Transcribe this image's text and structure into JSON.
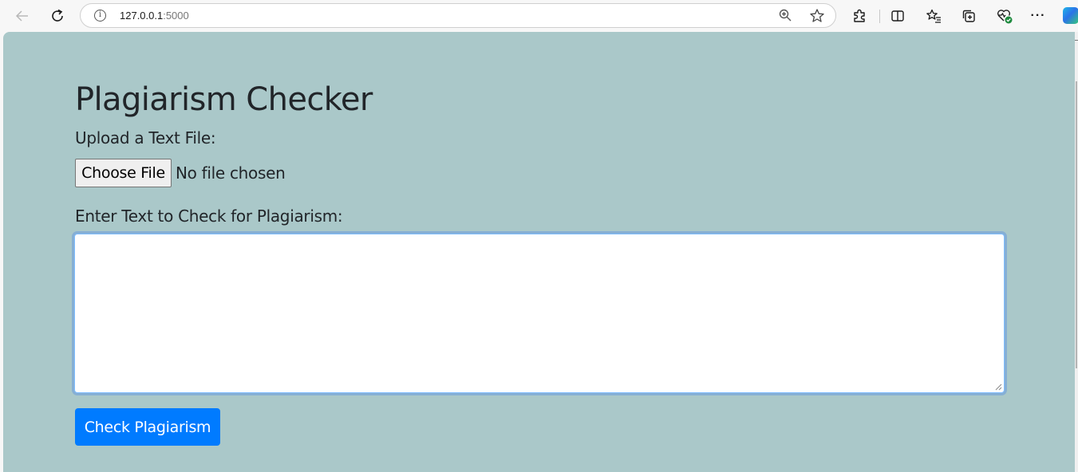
{
  "browser": {
    "url_host": "127.0.0.1",
    "url_port": ":5000",
    "icons": {
      "back": "arrow-left",
      "reload": "reload",
      "site_info": "info-circle",
      "zoom": "zoom-in-magnifier",
      "favorite": "star-outline",
      "extensions": "puzzle-piece",
      "split_screen": "split-screen",
      "favorites": "star-list",
      "collections": "collections",
      "browser_essentials": "heart-pulse",
      "menu": "more-dots",
      "copilot": "copilot-logo"
    }
  },
  "page": {
    "background_color": "#aac8c9",
    "title": "Plagiarism Checker",
    "upload_label": "Upload a Text File:",
    "choose_file_label": "Choose File",
    "no_file_text": "No file chosen",
    "text_label": "Enter Text to Check for Plagiarism:",
    "text_value": "",
    "submit_label": "Check Plagiarism",
    "submit_color": "#007bff"
  }
}
